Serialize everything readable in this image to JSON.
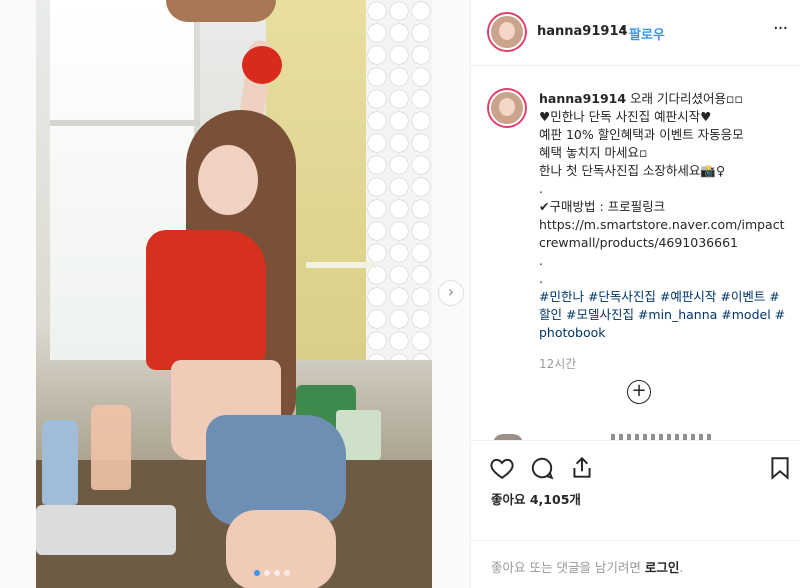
{
  "post": {
    "username": "hanna91914",
    "separator": "•",
    "follow_label": "팔로우",
    "more_label": "···",
    "caption_lines": [
      "오래 기다리셨어용▫▫",
      "♥민한나 단독 사진집 예판시작♥",
      "예판 10% 할인혜택과 이벤트 자동응모",
      "혜택 놓치지 마세요▫",
      "한나 첫 단독사진집 소장하세요📸♀",
      ".",
      "✔구매방법 : 프로필링크",
      "https://m.smartstore.naver.com/impactcrewmall/products/4691036661",
      ".",
      ".",
      "#민한나 #단독사진집 #예판시작 #이벤트 #할인 #모델사진집 #min_hanna #model #photobook"
    ],
    "time": "12시간",
    "load_more": "+",
    "likes": "좋아요 4,105개"
  },
  "login": {
    "prompt": "좋아요 또는 댓글을 남기려면 ",
    "link": "로그인",
    "suffix": "."
  },
  "carousel": {
    "next_label": "›",
    "page_count": 4,
    "active_index": 0
  },
  "icons": {
    "like": "heart-icon",
    "comment": "comment-icon",
    "share": "share-icon",
    "save": "bookmark-icon"
  },
  "colors": {
    "accent": "#3897f0",
    "text": "#262626",
    "muted": "#999999",
    "hashtag": "#003569",
    "story_ring": "#e03f6a"
  }
}
